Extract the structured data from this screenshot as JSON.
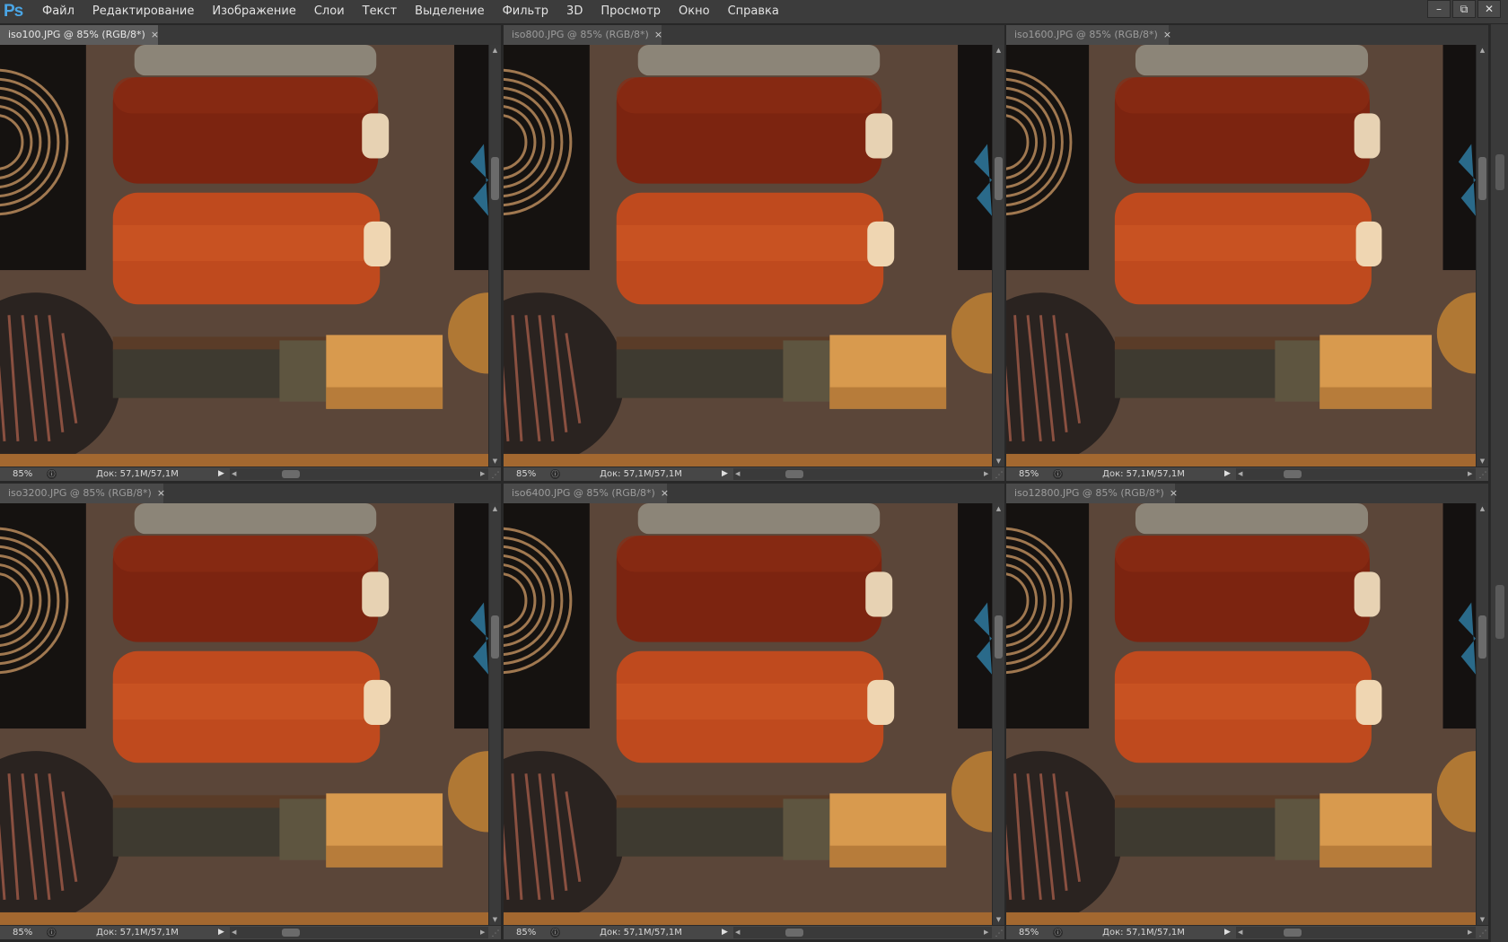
{
  "app": {
    "logo": "Ps",
    "menu": [
      "Файл",
      "Редактирование",
      "Изображение",
      "Слои",
      "Текст",
      "Выделение",
      "Фильтр",
      "3D",
      "Просмотр",
      "Окно",
      "Справка"
    ],
    "window_controls": {
      "minimize": "–",
      "restore": "⧉",
      "close": "✕"
    }
  },
  "documents": [
    {
      "tab_label": "iso100.JPG @ 85% (RGB/8*)",
      "zoom": "85%",
      "doc_info": "Док: 57,1M/57,1M",
      "active": true
    },
    {
      "tab_label": "iso800.JPG @ 85% (RGB/8*)",
      "zoom": "85%",
      "doc_info": "Док: 57,1M/57,1M",
      "active": false
    },
    {
      "tab_label": "iso1600.JPG @ 85% (RGB/8*)",
      "zoom": "85%",
      "doc_info": "Док: 57,1M/57,1M",
      "active": false
    },
    {
      "tab_label": "iso3200.JPG @ 85% (RGB/8*)",
      "zoom": "85%",
      "doc_info": "Док: 57,1M/57,1M",
      "active": false
    },
    {
      "tab_label": "iso6400.JPG @ 85% (RGB/8*)",
      "zoom": "85%",
      "doc_info": "Док: 57,1M/57,1M",
      "active": false
    },
    {
      "tab_label": "iso12800.JPG @ 85% (RGB/8*)",
      "zoom": "85%",
      "doc_info": "Док: 57,1M/57,1M",
      "active": false
    }
  ],
  "icons": {
    "tab_close": "×",
    "status_play": "▶",
    "scroll_up": "▲",
    "scroll_down": "▼",
    "scroll_left": "◀",
    "scroll_right": "▶"
  },
  "colors": {
    "menubar": "#3c3c3c",
    "workspace": "#282828",
    "ps_logo": "#4aa6e6"
  }
}
